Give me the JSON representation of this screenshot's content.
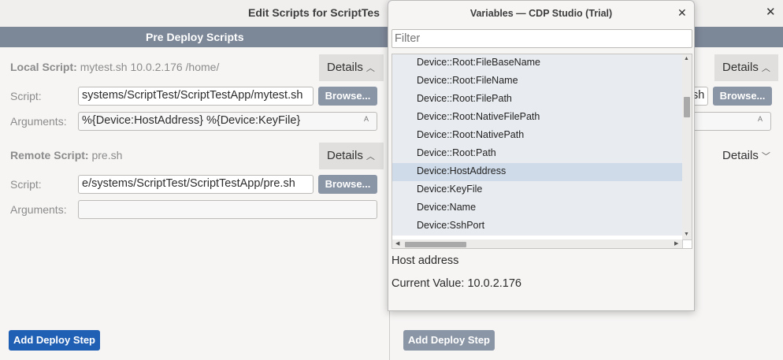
{
  "window": {
    "title": "Edit Scripts for ScriptTes",
    "close_glyph": "✕"
  },
  "left_pane": {
    "header": "Pre Deploy Scripts",
    "local_script": {
      "label": "Local Script:",
      "value": "mytest.sh 10.0.2.176 /home/",
      "details_label": "Details",
      "script_label": "Script:",
      "script_value": "systems/ScriptTest/ScriptTestApp/mytest.sh",
      "browse_label": "Browse...",
      "arguments_label": "Arguments:",
      "arguments_value": "%{Device:HostAddress} %{Device:KeyFile}"
    },
    "remote_script": {
      "label": "Remote Script:",
      "value": "pre.sh",
      "details_label": "Details",
      "script_label": "Script:",
      "script_value": "e/systems/ScriptTest/ScriptTestApp/pre.sh",
      "browse_label": "Browse...",
      "arguments_label": "Arguments:",
      "arguments_value": ""
    },
    "add_step_label": "Add Deploy Step"
  },
  "right_pane": {
    "details_top_label": "Details",
    "script_partial": "sh",
    "browse_label": "Browse...",
    "details_bottom_label": "Details",
    "add_step_label": "Add Deploy Step"
  },
  "dialog": {
    "title": "Variables — CDP Studio (Trial)",
    "close_glyph": "✕",
    "filter_placeholder": "Filter",
    "items": [
      "Device::Root:FileBaseName",
      "Device::Root:FileName",
      "Device::Root:FilePath",
      "Device::Root:NativeFilePath",
      "Device::Root:NativePath",
      "Device::Root:Path",
      "Device:HostAddress",
      "Device:KeyFile",
      "Device:Name",
      "Device:SshPort"
    ],
    "selected_item": "Device:HostAddress",
    "description": "Host address",
    "current_value_label": "Current Value: 10.0.2.176"
  },
  "icons": {
    "chevron_up": "chevron-up-icon",
    "chevron_down": "chevron-down-icon",
    "lock": "lock-icon"
  },
  "colors": {
    "section_bar": "#7c8797",
    "primary_button": "#1f5fb4",
    "disabled_button": "#8a95a5",
    "selection": "#cfdbe8"
  }
}
